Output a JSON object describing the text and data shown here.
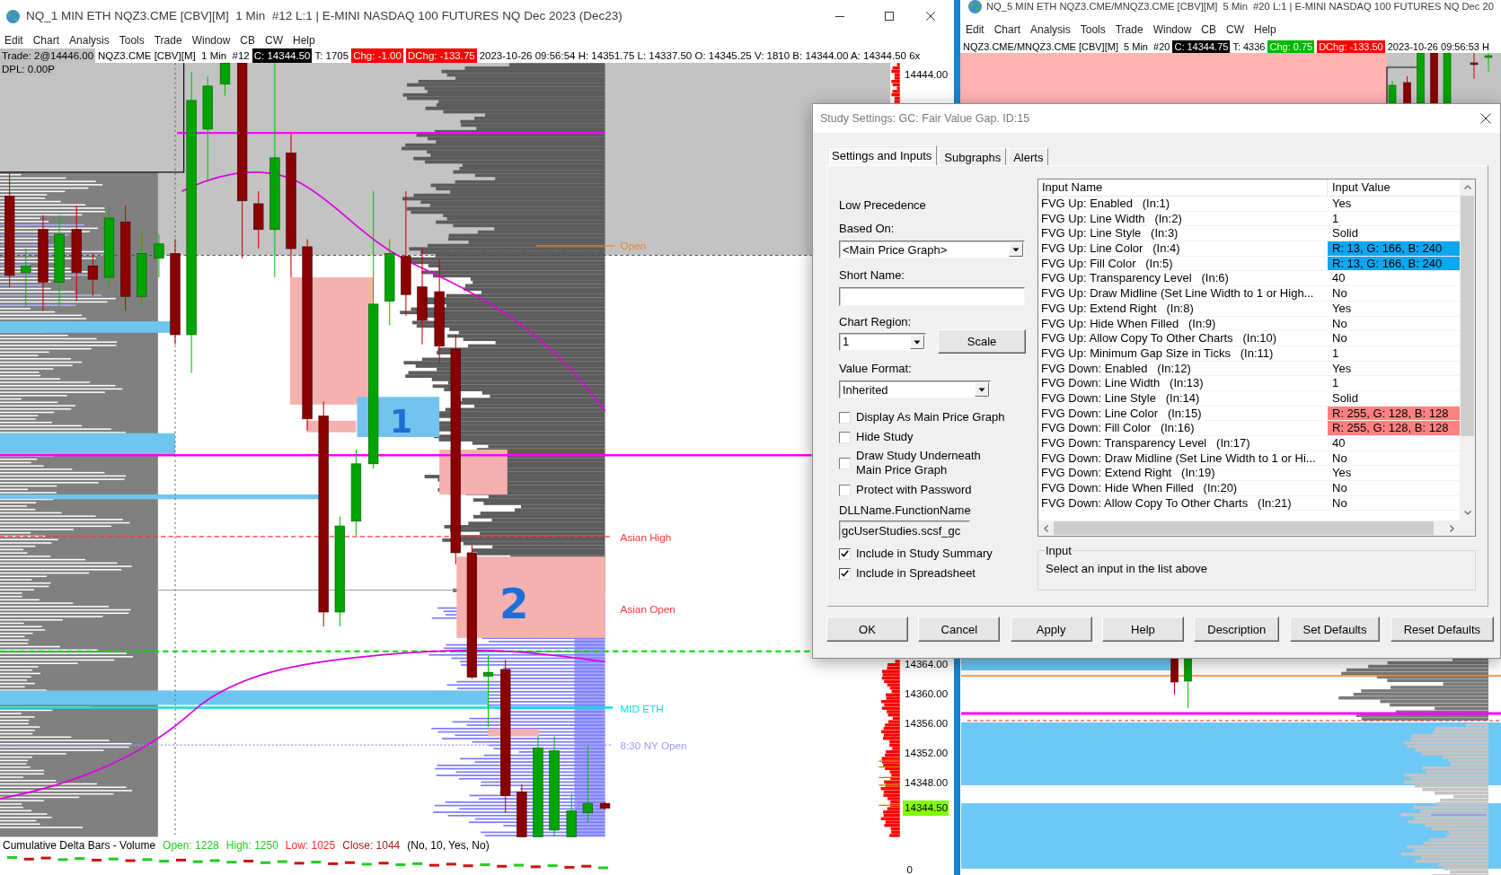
{
  "left_window": {
    "title": "NQ_1 MIN ETH NQZ3.CME [CBV][M]  1 Min  #12 L:1 | E-MINI NASDAQ 100 FUTURES NQ Dec 2023 (Dec23)",
    "menu": [
      "Edit",
      "Chart",
      "Analysis",
      "Tools",
      "Trade",
      "Window",
      "CB",
      "CW",
      "Help"
    ],
    "info_bar": [
      {
        "text": "Trade: 2@14446.00",
        "kind": "trade"
      },
      {
        "text": "NQZ3.CME [CBV][M]  1 Min  #12",
        "kind": "plain"
      },
      {
        "text": "C: 14344.50",
        "kind": "close"
      },
      {
        "text": "T: 1705",
        "kind": "plain"
      },
      {
        "text": "Chg: -1.00",
        "kind": "down"
      },
      {
        "text": "DChg: -133.75",
        "kind": "down"
      },
      {
        "text": "2023-10-26 09:56:54 H: 14351.75 L: 14337.50 O: 14345.25 V: 1810 B: 14344.00 A: 14344.50 6x",
        "kind": "plain"
      }
    ],
    "dpl": "DPL: 0.00P",
    "chart": {
      "levels": [
        {
          "label": "Open",
          "color": "#e8892e"
        },
        {
          "label": "Asian High",
          "color": "#ff3333"
        },
        {
          "label": "Asian Open",
          "color": "#ff3333"
        },
        {
          "label": "MID ETH",
          "color": "#00e0e0"
        },
        {
          "label": "8:30 NY Open",
          "color": "#9a9aff"
        }
      ],
      "annotations": [
        "1",
        "2"
      ],
      "price_axis": [
        {
          "label": "14444.00",
          "current": false
        },
        {
          "label": "14364.00",
          "current": false
        },
        {
          "label": "14360.00",
          "current": false
        },
        {
          "label": "14356.00",
          "current": false
        },
        {
          "label": "14352.00",
          "current": false
        },
        {
          "label": "14348.00",
          "current": false
        },
        {
          "label": "14344.50",
          "current": true
        }
      ]
    },
    "lower_pane": {
      "title": "Cumulative Delta Bars - Volume",
      "values": [
        {
          "text": "Open: 1228",
          "color": "#22cc22"
        },
        {
          "text": "High: 1250",
          "color": "#22cc22"
        },
        {
          "text": "Low: 1025",
          "color": "#ff2a2a"
        },
        {
          "text": "Close: 1044",
          "color": "#a52020"
        }
      ],
      "parameters": "(No, 10, Yes, No)",
      "axis_label": "0"
    }
  },
  "right_window": {
    "title": "NQ_5 MIN ETH NQZ3.CME/MNQZ3.CME [CBV][M]  5 Min  #20 L:1 | E-MINI NASDAQ 100 FUTURES NQ Dec 20",
    "menu": [
      "Edit",
      "Chart",
      "Analysis",
      "Tools",
      "Trade",
      "Window",
      "CB",
      "CW",
      "Help"
    ],
    "info_bar": [
      {
        "text": "NQZ3.CME/MNQZ3.CME [CBV][M]  5 Min  #20",
        "kind": "plain"
      },
      {
        "text": "C: 14344.75",
        "kind": "close"
      },
      {
        "text": "T: 4336",
        "kind": "plain"
      },
      {
        "text": "Chg: 0.75",
        "kind": "up"
      },
      {
        "text": "DChg: -133.50",
        "kind": "down"
      },
      {
        "text": "2023-10-26 09:56:53 H",
        "kind": "plain"
      }
    ]
  },
  "dialog": {
    "title": "Study Settings: GC: Fair Value Gap. ID:15",
    "tabs": [
      {
        "label": "Settings and Inputs",
        "selected": true
      },
      {
        "label": "Subgraphs",
        "selected": false
      },
      {
        "label": "Alerts",
        "selected": false
      }
    ],
    "precedence": "Low Precedence",
    "based_on": {
      "label": "Based On:",
      "value": "<Main Price Graph>"
    },
    "short_name": {
      "label": "Short Name:"
    },
    "chart_region": {
      "label": "Chart Region:",
      "value": "1"
    },
    "scale_button": "Scale",
    "value_format": {
      "label": "Value Format:",
      "value": "Inherited"
    },
    "options": [
      {
        "label": "Display As Main Price Graph",
        "checked": false
      },
      {
        "label": "Hide Study",
        "checked": false
      },
      {
        "label": "Draw Study Underneath Main Price Graph",
        "checked": false
      },
      {
        "label": "Protect with Password",
        "checked": false
      }
    ],
    "dll": {
      "label": "DLLName.FunctionName",
      "value": "gcUserStudies.scsf_gc"
    },
    "summary_options": [
      {
        "label": "Include in Study Summary",
        "checked": true
      },
      {
        "label": "Include in Spreadsheet",
        "checked": true
      }
    ],
    "table": {
      "columns": [
        "Input Name",
        "Input Value"
      ],
      "rows": [
        {
          "name": "FVG Up: Enabled   (In:1)",
          "value": "Yes"
        },
        {
          "name": "FVG Up: Line Width   (In:2)",
          "value": "1"
        },
        {
          "name": "FVG Up: Line Style   (In:3)",
          "value": "Solid"
        },
        {
          "name": "FVG Up: Line Color   (In:4)",
          "value": "R: 13, G: 166, B: 240",
          "color": "#0da6f0"
        },
        {
          "name": "FVG Up: Fill Color   (In:5)",
          "value": "R: 13, G: 166, B: 240",
          "color": "#0da6f0"
        },
        {
          "name": "FVG Up: Transparency Level   (In:6)",
          "value": "40"
        },
        {
          "name": "FVG Up: Draw Midline (Set Line Width to 1 or High...",
          "value": "No"
        },
        {
          "name": "FVG Up: Extend Right   (In:8)",
          "value": "Yes"
        },
        {
          "name": "FVG Up: Hide When Filled   (In:9)",
          "value": "No"
        },
        {
          "name": "FVG Up: Allow Copy To Other Charts   (In:10)",
          "value": "No"
        },
        {
          "name": "FVG Up: Minimum Gap Size in Ticks   (In:11)",
          "value": "1"
        },
        {
          "name": "FVG Down: Enabled   (In:12)",
          "value": "Yes"
        },
        {
          "name": "FVG Down: Line Width   (In:13)",
          "value": "1"
        },
        {
          "name": "FVG Down: Line Style   (In:14)",
          "value": "Solid"
        },
        {
          "name": "FVG Down: Line Color   (In:15)",
          "value": "R: 255, G: 128, B: 128",
          "color": "#ff8080"
        },
        {
          "name": "FVG Down: Fill Color   (In:16)",
          "value": "R: 255, G: 128, B: 128",
          "color": "#ff8080"
        },
        {
          "name": "FVG Down: Transparency Level   (In:17)",
          "value": "40"
        },
        {
          "name": "FVG Down: Draw Midline (Set Line Width to 1 or Hi...",
          "value": "No"
        },
        {
          "name": "FVG Down: Extend Right   (In:19)",
          "value": "Yes"
        },
        {
          "name": "FVG Down: Hide When Filled   (In:20)",
          "value": "No"
        },
        {
          "name": "FVG Down: Allow Copy To Other Charts   (In:21)",
          "value": "No"
        }
      ]
    },
    "input_group": {
      "label": "Input",
      "text": "Select an input in the list above"
    },
    "buttons": [
      "OK",
      "Cancel",
      "Apply",
      "Help",
      "Description",
      "Set Defaults",
      "Reset Defaults"
    ]
  }
}
